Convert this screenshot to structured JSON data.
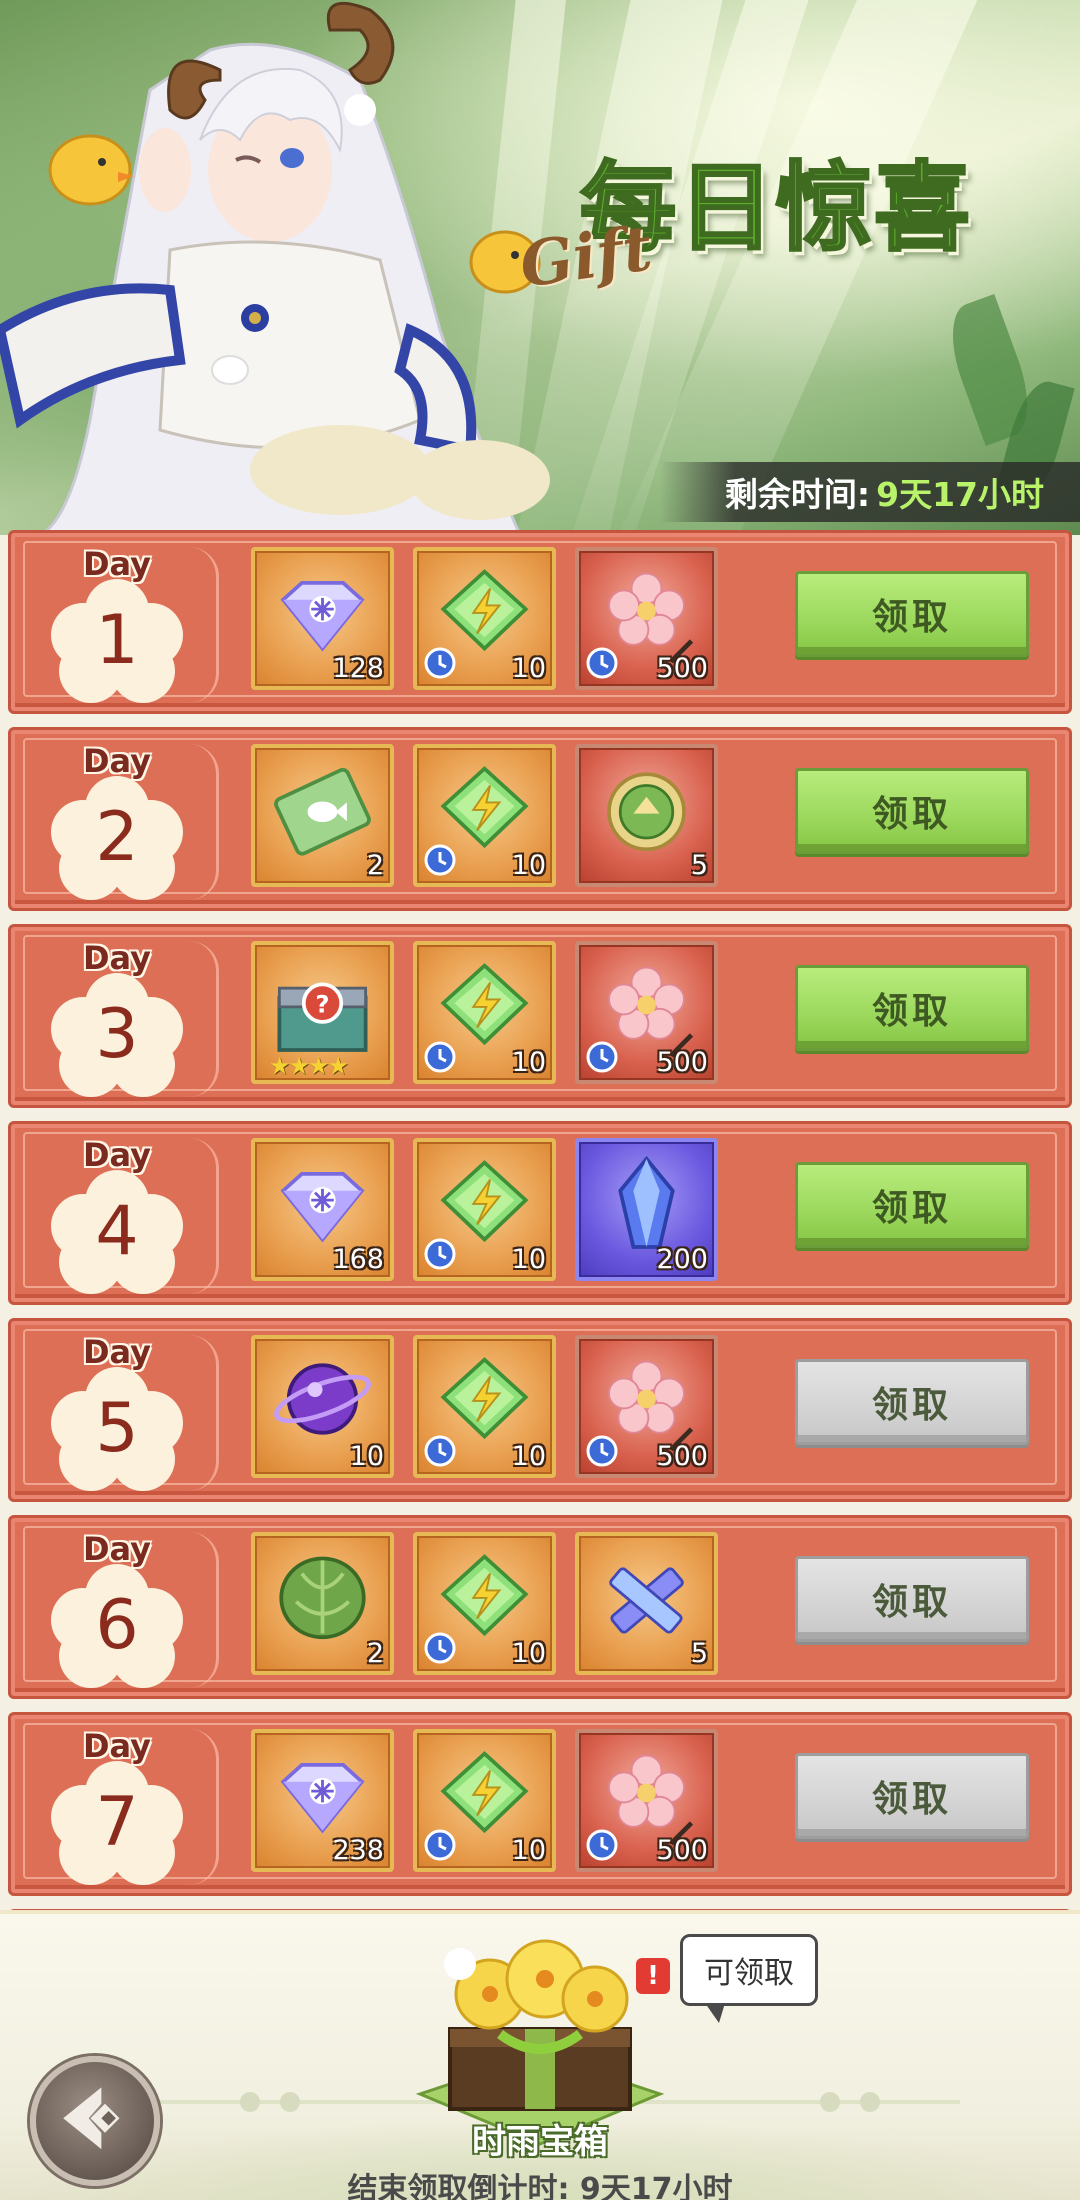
{
  "banner": {
    "title_part1": "每日",
    "title_part2": "惊喜",
    "title_gift": "Gift",
    "remaining_label": "剩余时间:",
    "remaining_value": "9天17小时"
  },
  "days": [
    {
      "label": "Day",
      "number": "1",
      "claimable": true,
      "button": "领取",
      "items": [
        {
          "icon": "rainbow-diamond-icon",
          "qty": "128",
          "timed": false,
          "frame": "gold"
        },
        {
          "icon": "energy-crystal-icon",
          "qty": "10",
          "timed": true,
          "frame": "gold"
        },
        {
          "icon": "cherry-blossom-icon",
          "qty": "500",
          "timed": true,
          "frame": "pink"
        }
      ]
    },
    {
      "label": "Day",
      "number": "2",
      "claimable": true,
      "button": "领取",
      "items": [
        {
          "icon": "fish-ticket-icon",
          "qty": "2",
          "timed": false,
          "frame": "gold"
        },
        {
          "icon": "energy-crystal-icon",
          "qty": "10",
          "timed": true,
          "frame": "gold"
        },
        {
          "icon": "green-emblem-icon",
          "qty": "5",
          "timed": false,
          "frame": "pink"
        }
      ]
    },
    {
      "label": "Day",
      "number": "3",
      "claimable": true,
      "button": "领取",
      "items": [
        {
          "icon": "mystery-chest-icon",
          "qty": "",
          "timed": false,
          "frame": "gold",
          "stars": "★★★★"
        },
        {
          "icon": "energy-crystal-icon",
          "qty": "10",
          "timed": true,
          "frame": "gold"
        },
        {
          "icon": "cherry-blossom-icon",
          "qty": "500",
          "timed": true,
          "frame": "pink"
        }
      ]
    },
    {
      "label": "Day",
      "number": "4",
      "claimable": true,
      "button": "领取",
      "items": [
        {
          "icon": "rainbow-diamond-icon",
          "qty": "168",
          "timed": false,
          "frame": "gold"
        },
        {
          "icon": "energy-crystal-icon",
          "qty": "10",
          "timed": true,
          "frame": "gold"
        },
        {
          "icon": "blue-crystal-icon",
          "qty": "200",
          "timed": false,
          "frame": "purple"
        }
      ]
    },
    {
      "label": "Day",
      "number": "5",
      "claimable": false,
      "button": "领取",
      "items": [
        {
          "icon": "purple-orb-icon",
          "qty": "10",
          "timed": false,
          "frame": "gold"
        },
        {
          "icon": "energy-crystal-icon",
          "qty": "10",
          "timed": true,
          "frame": "gold"
        },
        {
          "icon": "cherry-blossom-icon",
          "qty": "500",
          "timed": true,
          "frame": "pink"
        }
      ]
    },
    {
      "label": "Day",
      "number": "6",
      "claimable": false,
      "button": "领取",
      "items": [
        {
          "icon": "cabbage-icon",
          "qty": "2",
          "timed": false,
          "frame": "gold"
        },
        {
          "icon": "energy-crystal-icon",
          "qty": "10",
          "timed": true,
          "frame": "gold"
        },
        {
          "icon": "crossed-crystals-icon",
          "qty": "5",
          "timed": false,
          "frame": "gold"
        }
      ]
    },
    {
      "label": "Day",
      "number": "7",
      "claimable": false,
      "button": "领取",
      "items": [
        {
          "icon": "rainbow-diamond-icon",
          "qty": "238",
          "timed": false,
          "frame": "gold"
        },
        {
          "icon": "energy-crystal-icon",
          "qty": "10",
          "timed": true,
          "frame": "gold"
        },
        {
          "icon": "cherry-blossom-icon",
          "qty": "500",
          "timed": true,
          "frame": "pink"
        }
      ]
    }
  ],
  "footer": {
    "chest_name": "时雨宝箱",
    "alert": "!",
    "bubble": "可领取",
    "countdown": "结束领取倒计时: 9天17小时"
  },
  "colors": {
    "row_bg": "#de6f57",
    "claim_green": "#9bd85c",
    "claim_disabled": "#d3d3d3",
    "timer_value": "#b9f36a"
  }
}
